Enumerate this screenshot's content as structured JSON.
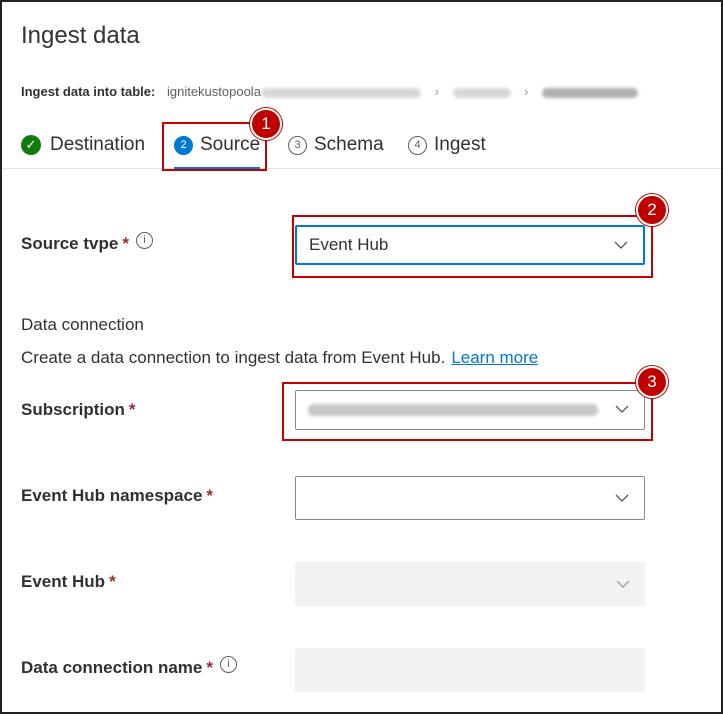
{
  "page": {
    "title": "Ingest data"
  },
  "breadcrumb": {
    "label": "Ingest data into table:",
    "cluster_prefix": "ignitekustopoola"
  },
  "tabs": [
    {
      "num": "",
      "label": "Destination",
      "state": "done"
    },
    {
      "num": "2",
      "label": "Source",
      "state": "active"
    },
    {
      "num": "3",
      "label": "Schema",
      "state": "pending"
    },
    {
      "num": "4",
      "label": "Ingest",
      "state": "pending"
    }
  ],
  "callouts": [
    "1",
    "2",
    "3"
  ],
  "form": {
    "source_type": {
      "label": "Source tvpe",
      "required": "*",
      "info": "i",
      "value": "Event Hub"
    },
    "data_connection": {
      "heading": "Data connection",
      "description": "Create a data connection to ingest data from Event Hub.",
      "learn_more": "Learn more"
    },
    "subscription": {
      "label": "Subscription",
      "required": "*"
    },
    "namespace": {
      "label": "Event Hub namespace",
      "required": "*",
      "value": ""
    },
    "event_hub": {
      "label": "Event Hub",
      "required": "*",
      "value": ""
    },
    "connection_name": {
      "label": "Data connection name",
      "required": "*",
      "info": "i",
      "value": ""
    }
  },
  "colors": {
    "accent": "#0078d4",
    "success": "#107c10",
    "callout": "#c00000",
    "disabled_bg": "#f3f2f1"
  }
}
